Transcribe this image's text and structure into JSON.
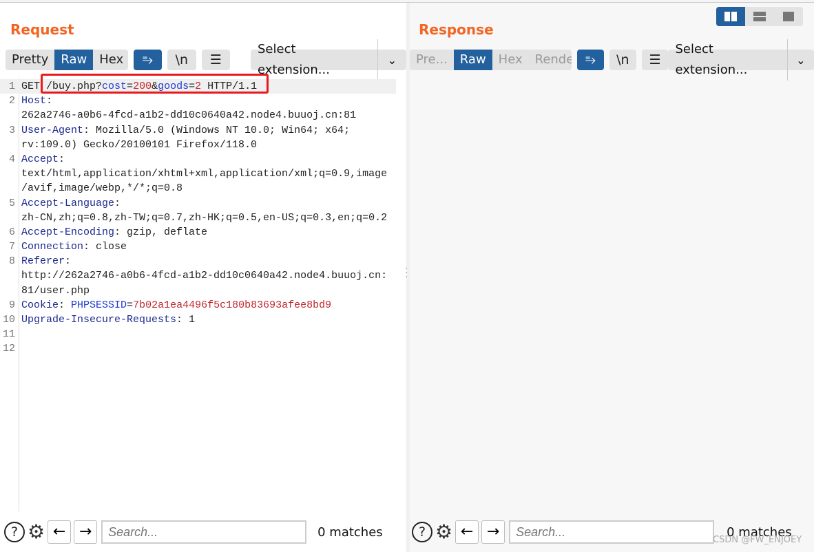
{
  "request": {
    "title": "Request",
    "tabs": [
      {
        "label": "Pretty",
        "state": "normal"
      },
      {
        "label": "Raw",
        "state": "active"
      },
      {
        "label": "Hex",
        "state": "normal"
      }
    ],
    "wrap_icon": "wrap-lines-icon",
    "newline_label": "\\n",
    "menu_icon": "hamburger-icon",
    "extension_select": "Select extension...",
    "lines": [
      {
        "n": "1",
        "rows": [
          [
            [
              "GET ",
              "plain"
            ],
            [
              "/buy.php?",
              "plain"
            ],
            [
              "cost",
              "param"
            ],
            [
              "=",
              "plain"
            ],
            [
              "200",
              "val"
            ],
            [
              "&",
              "plain"
            ],
            [
              "goods",
              "param"
            ],
            [
              "=",
              "plain"
            ],
            [
              "2",
              "val"
            ],
            [
              " HTTP/1.1",
              "plain"
            ]
          ]
        ]
      },
      {
        "n": "2",
        "rows": [
          [
            [
              "Host",
              "key"
            ],
            [
              ":",
              "plain"
            ]
          ],
          [
            [
              "262a2746-a0b6-4fcd-a1b2-dd10c0640a42.node4.buuoj.cn:81",
              "plain"
            ]
          ]
        ]
      },
      {
        "n": "3",
        "rows": [
          [
            [
              "User-Agent",
              "key"
            ],
            [
              ": Mozilla/5.0 (Windows NT 10.0; Win64; x64;",
              "plain"
            ]
          ],
          [
            [
              "rv:109.0) Gecko/20100101 Firefox/118.0",
              "plain"
            ]
          ]
        ]
      },
      {
        "n": "4",
        "rows": [
          [
            [
              "Accept",
              "key"
            ],
            [
              ":",
              "plain"
            ]
          ],
          [
            [
              "text/html,application/xhtml+xml,application/xml;q=0.9,image",
              "plain"
            ]
          ],
          [
            [
              "/avif,image/webp,*/*;q=0.8",
              "plain"
            ]
          ]
        ]
      },
      {
        "n": "5",
        "rows": [
          [
            [
              "Accept-Language",
              "key"
            ],
            [
              ":",
              "plain"
            ]
          ],
          [
            [
              "zh-CN,zh;q=0.8,zh-TW;q=0.7,zh-HK;q=0.5,en-US;q=0.3,en;q=0.2",
              "plain"
            ]
          ]
        ]
      },
      {
        "n": "6",
        "rows": [
          [
            [
              "Accept-Encoding",
              "key"
            ],
            [
              ": gzip, deflate",
              "plain"
            ]
          ]
        ]
      },
      {
        "n": "7",
        "rows": [
          [
            [
              "Connection",
              "key"
            ],
            [
              ": close",
              "plain"
            ]
          ]
        ]
      },
      {
        "n": "8",
        "rows": [
          [
            [
              "Referer",
              "key"
            ],
            [
              ":",
              "plain"
            ]
          ],
          [
            [
              "http://262a2746-a0b6-4fcd-a1b2-dd10c0640a42.node4.buuoj.cn:",
              "plain"
            ]
          ],
          [
            [
              "81/user.php",
              "plain"
            ]
          ]
        ]
      },
      {
        "n": "9",
        "rows": [
          [
            [
              "Cookie",
              "key"
            ],
            [
              ": ",
              "plain"
            ],
            [
              "PHPSESSID",
              "param"
            ],
            [
              "=",
              "plain"
            ],
            [
              "7b02a1ea4496f5c180b83693afee8bd9",
              "val"
            ]
          ]
        ]
      },
      {
        "n": "10",
        "rows": [
          [
            [
              "Upgrade-Insecure-Requests",
              "key"
            ],
            [
              ": 1",
              "plain"
            ]
          ]
        ]
      },
      {
        "n": "11",
        "rows": [
          []
        ]
      },
      {
        "n": "12",
        "rows": [
          []
        ]
      }
    ],
    "search_placeholder": "Search...",
    "matches": "0 matches"
  },
  "response": {
    "title": "Response",
    "tabs": [
      {
        "label": "Pre...",
        "state": "disabled"
      },
      {
        "label": "Raw",
        "state": "active"
      },
      {
        "label": "Hex",
        "state": "disabled"
      },
      {
        "label": "Render",
        "state": "disabled"
      }
    ],
    "newline_label": "\\n",
    "extension_select": "Select extension...",
    "search_placeholder": "Search...",
    "matches": "0 matches"
  },
  "layout_modes": [
    {
      "icon": "split-vertical-icon",
      "active": true
    },
    {
      "icon": "split-horizontal-icon",
      "active": false
    },
    {
      "icon": "single-pane-icon",
      "active": false
    }
  ],
  "colors": {
    "accent": "#23609e",
    "title": "#f26522",
    "highlight_box": "#e8191d"
  },
  "watermark": "CSDN @FW_ENJOEY"
}
